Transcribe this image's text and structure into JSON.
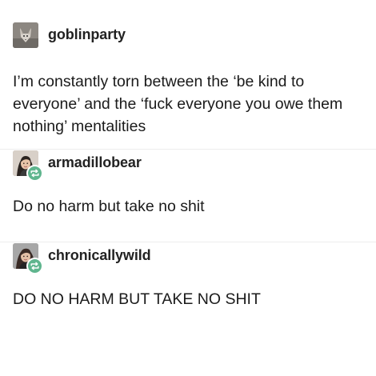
{
  "posts": [
    {
      "username": "goblinparty",
      "text": "I’m constantly torn between the ‘be kind to everyone’ and the ‘fuck everyone you owe them nothing’ mentalities",
      "avatar_icon": "fox-avatar-icon",
      "reblogged": false
    },
    {
      "username": "armadillobear",
      "text": "Do no harm but take no shit",
      "avatar_icon": "person-avatar-icon",
      "reblogged": true
    },
    {
      "username": "chronicallywild",
      "text": "DO NO HARM BUT TAKE NO SHIT",
      "avatar_icon": "person-avatar-icon",
      "reblogged": true
    }
  ],
  "colors": {
    "text": "#1b1b1b",
    "username": "#222222",
    "reblog_badge": "#5fb58e",
    "divider": "#ececec"
  }
}
